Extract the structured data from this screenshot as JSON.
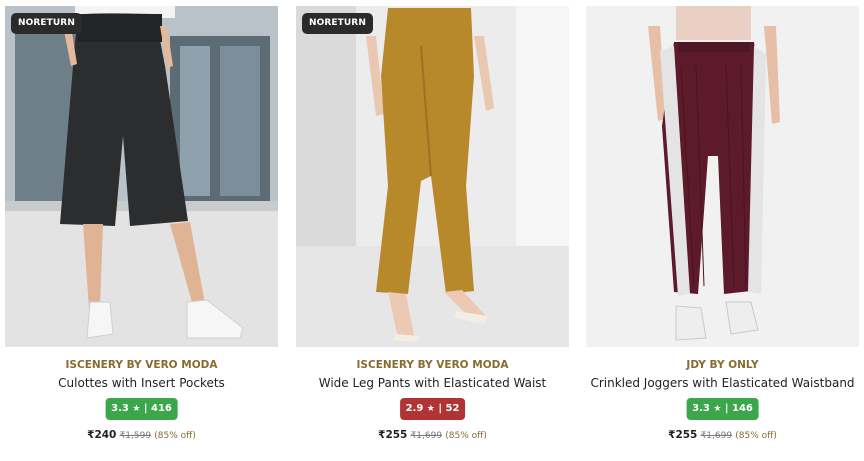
{
  "products": [
    {
      "tag": "NORETURN",
      "brand": "ISCENERY BY VERO MODA",
      "title": "Culottes with Insert Pockets",
      "rating": "3.3",
      "star": "★",
      "reviews": "| 416",
      "rating_color": "#3ca64a",
      "price": "₹240",
      "mrp": "₹1,599",
      "discount": "(85% off)",
      "image_desc": "black-culottes"
    },
    {
      "tag": "NORETURN",
      "brand": "ISCENERY BY VERO MODA",
      "title": "Wide Leg Pants with Elasticated Waist",
      "rating": "2.9",
      "star": "★",
      "reviews": "| 52",
      "rating_color": "#b03434",
      "price": "₹255",
      "mrp": "₹1,699",
      "discount": "(85% off)",
      "image_desc": "mustard-flared-pants"
    },
    {
      "brand": "JDY BY ONLY",
      "title": "Crinkled Joggers with Elasticated Waistband",
      "rating": "3.3",
      "star": "★",
      "reviews": "| 146",
      "rating_color": "#3ca64a",
      "price": "₹255",
      "mrp": "₹1,699",
      "discount": "(85% off)",
      "image_desc": "maroon-crinkled-joggers"
    }
  ]
}
